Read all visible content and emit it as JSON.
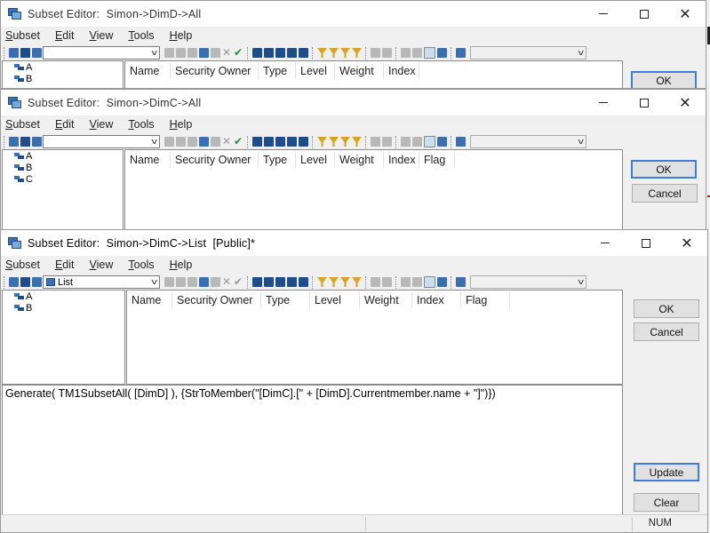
{
  "window_controls": {
    "minimize": "",
    "maximize": "",
    "close": "✕"
  },
  "menu": [
    "Subset",
    "Edit",
    "View",
    "Tools",
    "Help"
  ],
  "windows": [
    {
      "title": "Subset Editor:  Simon->DimD->All",
      "combo_value": "",
      "tree_items": [
        "A",
        "B"
      ],
      "columns": [
        "Name",
        "Security Owner",
        "Type",
        "Level",
        "Weight",
        "Index"
      ],
      "buttons": {
        "ok": "OK"
      }
    },
    {
      "title": "Subset Editor:  Simon->DimC->All",
      "combo_value": "",
      "tree_items": [
        "A",
        "B",
        "C"
      ],
      "columns": [
        "Name",
        "Security Owner",
        "Type",
        "Level",
        "Weight",
        "Index",
        "Flag"
      ],
      "buttons": {
        "ok": "OK",
        "cancel": "Cancel"
      }
    },
    {
      "title": "Subset Editor:  Simon->DimC->List  [Public]*",
      "combo_value": "List",
      "tree_items": [
        "A",
        "B"
      ],
      "columns": [
        "Name",
        "Security Owner",
        "Type",
        "Level",
        "Weight",
        "Index",
        "Flag"
      ],
      "buttons": {
        "ok": "OK",
        "cancel": "Cancel",
        "update": "Update",
        "clear": "Clear"
      },
      "expression": "Generate( TM1SubsetAll( [DimD] ), {StrToMember(\"[DimC].[\" + [DimD].Currentmember.name + \"]\")})",
      "status": {
        "num": "NUM"
      }
    }
  ]
}
